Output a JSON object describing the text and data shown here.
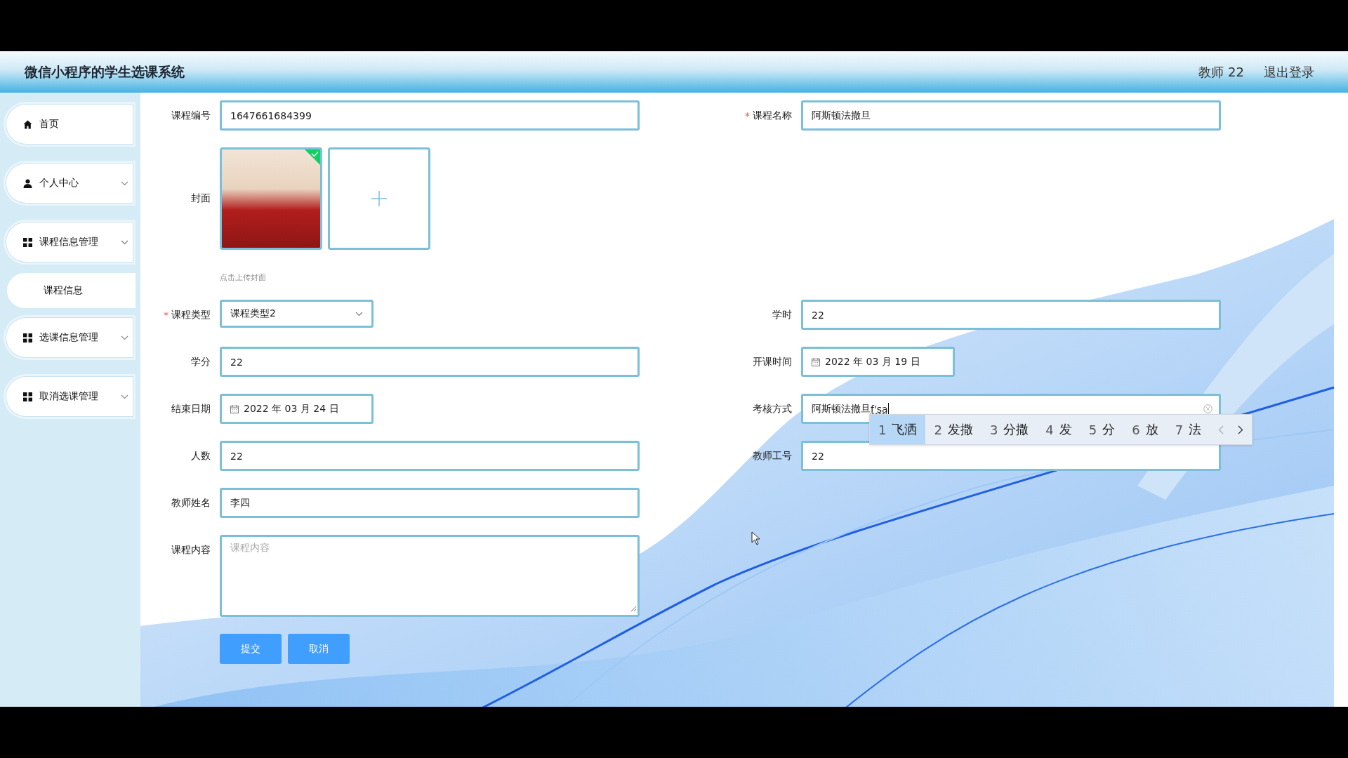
{
  "header": {
    "title": "微信小程序的学生选课系统",
    "user": "教师 22",
    "logout": "退出登录"
  },
  "sidebar": {
    "items": [
      {
        "label": "首页",
        "kind": "home"
      },
      {
        "label": "个人中心",
        "kind": "user",
        "expanded": false
      },
      {
        "label": "课程信息管理",
        "kind": "grid",
        "expanded": true,
        "children": [
          {
            "label": "课程信息"
          }
        ]
      },
      {
        "label": "选课信息管理",
        "kind": "grid",
        "expanded": false
      },
      {
        "label": "取消选课管理",
        "kind": "grid",
        "expanded": false
      }
    ]
  },
  "form": {
    "rows": [
      {
        "left": {
          "label": "课程编号",
          "kind": "text",
          "value": "1647661684399"
        },
        "right": {
          "label": "课程名称",
          "required_mark": "*",
          "kind": "text",
          "value": "阿斯顿法撤旦"
        }
      },
      {
        "left": {
          "label": "封面",
          "kind": "upload",
          "files": [
            {
              "uploaded": true
            }
          ],
          "hint": "点击上传封面"
        }
      },
      {
        "left": {
          "label": "课程类型",
          "required_mark": "*",
          "kind": "select",
          "value": "课程类型2"
        },
        "right": {
          "label": "学时",
          "kind": "text",
          "value": "22"
        }
      },
      {
        "left": {
          "label": "学分",
          "kind": "text",
          "value": "22"
        },
        "right": {
          "label": "开课时间",
          "kind": "date",
          "value": "2022 年 03 月 19 日"
        }
      },
      {
        "left": {
          "label": "结束日期",
          "kind": "date",
          "value": "2022 年 03 月 24 日"
        },
        "right": {
          "label": "考核方式",
          "kind": "text",
          "value": "阿斯顿法撤旦",
          "composing": "f'sa",
          "clearable": true,
          "ime": {
            "candidates": [
              {
                "number": "1",
                "text": "飞洒",
                "selected": true
              },
              {
                "number": "2",
                "text": "发撒",
                "selected": false
              },
              {
                "number": "3",
                "text": "分撒",
                "selected": false
              },
              {
                "number": "4",
                "text": "发",
                "selected": false
              },
              {
                "number": "5",
                "text": "分",
                "selected": false
              },
              {
                "number": "6",
                "text": "放",
                "selected": false
              },
              {
                "number": "7",
                "text": "法",
                "selected": false
              }
            ]
          }
        }
      },
      {
        "left": {
          "label": "人数",
          "kind": "text",
          "value": "22"
        },
        "right": {
          "label": "教师工号",
          "kind": "text",
          "value": "22"
        }
      },
      {
        "left": {
          "label": "教师姓名",
          "kind": "text",
          "value": "李四"
        }
      },
      {
        "left": {
          "label": "课程内容",
          "kind": "textarea",
          "placeholder": "课程内容"
        }
      }
    ],
    "buttons": [
      {
        "label": "提交"
      },
      {
        "label": "取消"
      }
    ]
  }
}
